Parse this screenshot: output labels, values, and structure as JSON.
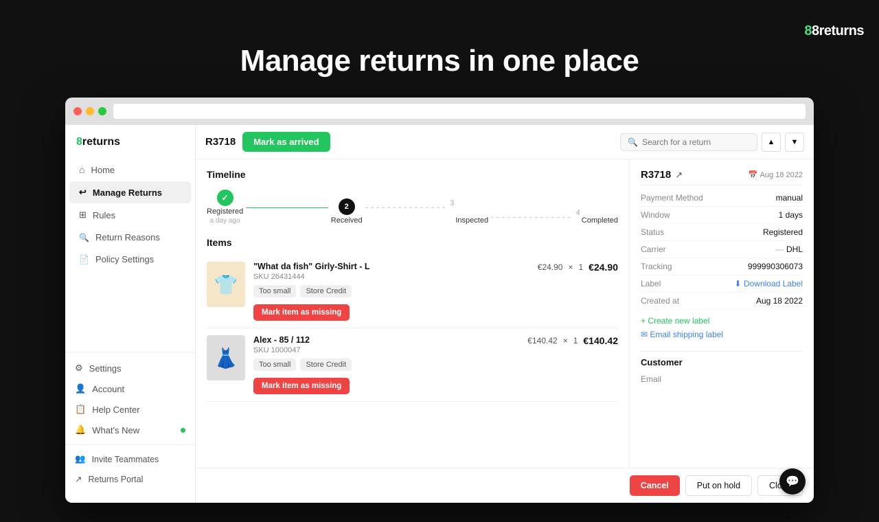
{
  "brand": {
    "name": "8returns",
    "logo_text": "8returns"
  },
  "headline": "Manage returns in one place",
  "browser": {
    "address": ""
  },
  "sidebar": {
    "logo": "8returns",
    "items": [
      {
        "id": "home",
        "label": "Home",
        "icon": "⌂",
        "active": false
      },
      {
        "id": "manage-returns",
        "label": "Manage Returns",
        "icon": "↩",
        "active": true
      },
      {
        "id": "rules",
        "label": "Rules",
        "icon": "⊞",
        "active": false
      },
      {
        "id": "return-reasons",
        "label": "Return Reasons",
        "icon": "🔍",
        "active": false
      },
      {
        "id": "policy-settings",
        "label": "Policy Settings",
        "icon": "📄",
        "active": false
      }
    ],
    "bottom_items": [
      {
        "id": "settings",
        "label": "Settings",
        "icon": "⚙",
        "active": false
      },
      {
        "id": "account",
        "label": "Account",
        "icon": "👤",
        "active": false
      },
      {
        "id": "help-center",
        "label": "Help Center",
        "icon": "📋",
        "active": false
      },
      {
        "id": "whats-new",
        "label": "What's New",
        "icon": "🔔",
        "active": false,
        "dot": true
      }
    ],
    "footer_items": [
      {
        "id": "invite-teammates",
        "label": "Invite Teammates",
        "icon": "👥"
      },
      {
        "id": "returns-portal",
        "label": "Returns Portal",
        "icon": "↗"
      }
    ]
  },
  "topbar": {
    "return_id": "R3718",
    "mark_arrived_label": "Mark as arrived",
    "search_placeholder": "Search for a return"
  },
  "timeline": {
    "title": "Timeline",
    "steps": [
      {
        "label": "Registered",
        "sublabel": "a day ago",
        "state": "done",
        "number": "✓"
      },
      {
        "label": "Received",
        "sublabel": "",
        "state": "active",
        "number": "2"
      },
      {
        "label": "Inspected",
        "sublabel": "",
        "state": "inactive",
        "number": "3"
      },
      {
        "label": "Completed",
        "sublabel": "",
        "state": "inactive",
        "number": "4"
      }
    ]
  },
  "items_section": {
    "title": "Items",
    "items": [
      {
        "name": "\"What da fish\" Girly-Shirt - L",
        "sku": "SKU   26431444",
        "tags": [
          "Too small",
          "Store Credit"
        ],
        "unit_price": "€24.90",
        "multiply": "×",
        "quantity": "1",
        "total_price": "€24.90",
        "emoji": "👕",
        "action_label": "Mark item as missing"
      },
      {
        "name": "Alex - 85 / 112",
        "sku": "SKU   1000047",
        "tags": [
          "Too small",
          "Store Credit"
        ],
        "unit_price": "€140.42",
        "multiply": "×",
        "quantity": "1",
        "total_price": "€140.42",
        "emoji": "👗",
        "action_label": "Mark item as missing"
      }
    ]
  },
  "right_panel": {
    "return_id": "R3718",
    "date_icon": "📅",
    "date": "Aug 18 2022",
    "fields": [
      {
        "label": "Payment Method",
        "value": "manual"
      },
      {
        "label": "Window",
        "value": "1 days"
      },
      {
        "label": "Status",
        "value": "Registered"
      },
      {
        "label": "Carrier",
        "value": "DHL",
        "has_dash": true
      },
      {
        "label": "Tracking",
        "value": "999990306073"
      },
      {
        "label": "Label",
        "value": "Download Label",
        "is_link": true,
        "link_type": "blue"
      },
      {
        "label": "Created at",
        "value": "Aug 18 2022"
      }
    ],
    "actions": [
      {
        "label": "+ Create new label",
        "type": "green"
      },
      {
        "label": "✉ Email shipping label",
        "type": "blue"
      }
    ],
    "customer_label": "Customer",
    "email_label": "Email"
  },
  "bottom_bar": {
    "cancel_label": "Cancel",
    "hold_label": "Put on hold",
    "close_label": "Close"
  }
}
